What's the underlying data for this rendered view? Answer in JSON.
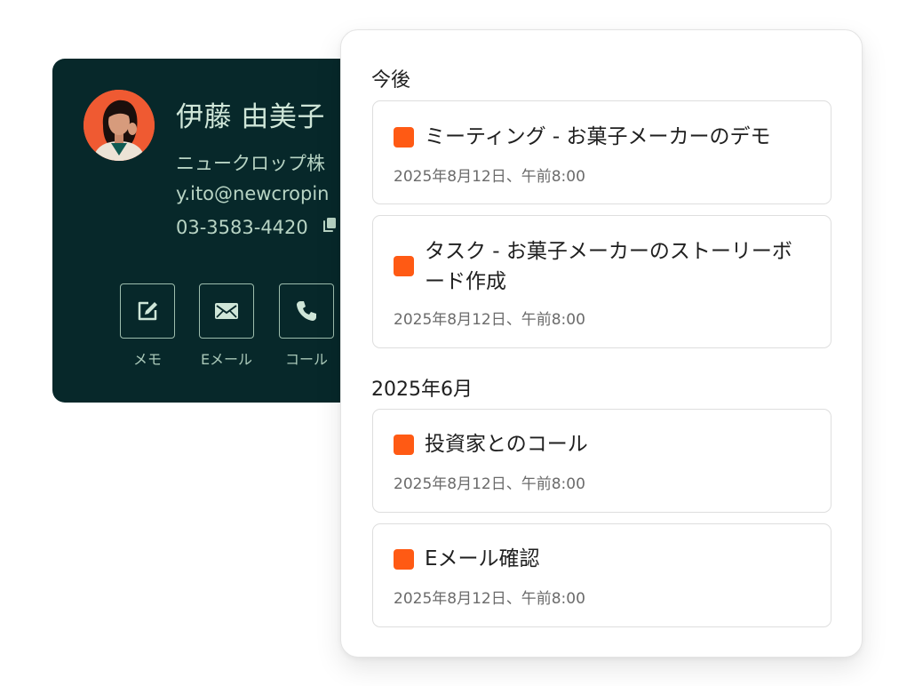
{
  "contact": {
    "name": "伊藤 由美子",
    "company": "ニュークロップ株",
    "email": "y.ito@newcropin",
    "phone": "03-3583-4420",
    "actions": [
      {
        "label": "メモ",
        "icon": "edit-icon"
      },
      {
        "label": "Eメール",
        "icon": "mail-icon"
      },
      {
        "label": "コール",
        "icon": "phone-icon"
      }
    ]
  },
  "timeline": {
    "sections": [
      {
        "title": "今後",
        "items": [
          {
            "title": "ミーティング - お菓子メーカーのデモ",
            "date": "2025年8月12日、午前8:00"
          },
          {
            "title": "タスク - お菓子メーカーのストーリーボード作成",
            "date": "2025年8月12日、午前8:00"
          }
        ]
      },
      {
        "title": "2025年6月",
        "items": [
          {
            "title": "投資家とのコール",
            "date": "2025年8月12日、午前8:00"
          },
          {
            "title": "Eメール確認",
            "date": "2025年8月12日、午前8:00"
          }
        ]
      }
    ]
  },
  "colors": {
    "card_background": "#07282a",
    "accent": "#ff5a14",
    "avatar_background": "#ef5a32"
  }
}
